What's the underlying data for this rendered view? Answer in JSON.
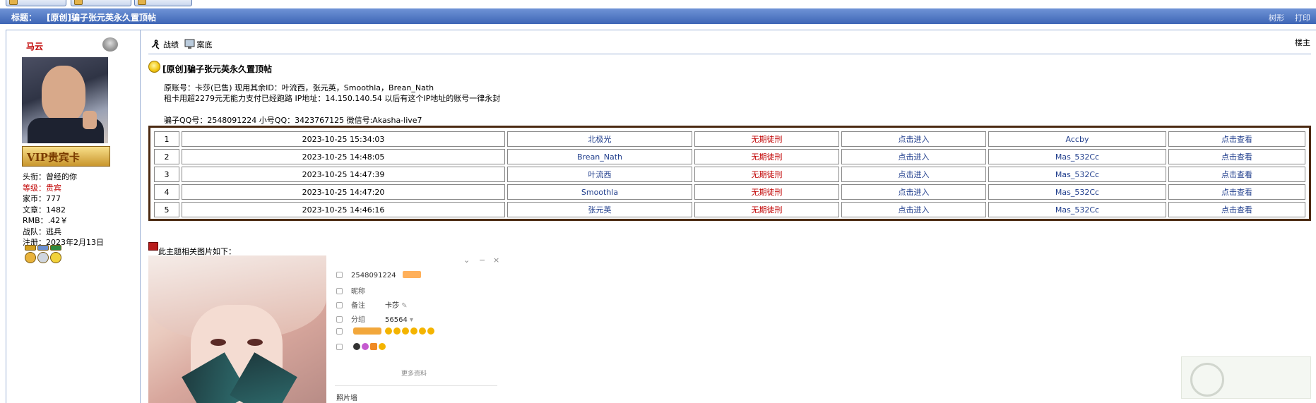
{
  "top_strip": {
    "buttons": [
      "",
      "",
      ""
    ],
    "right_text": [
      "",
      ""
    ]
  },
  "title_bar": {
    "label": "标题：",
    "title": "[原创]骗子张元英永久置顶帖",
    "tree_label": "树形",
    "print_label": "打印"
  },
  "user": {
    "name": "马云",
    "vip_card": "VIP贵宾卡",
    "info": [
      {
        "key": "头衔：",
        "value": "曾经的你",
        "highlight": false
      },
      {
        "key": "等级：",
        "value": "贵宾",
        "highlight": true
      },
      {
        "key": "家币：",
        "value": "777",
        "highlight": false
      },
      {
        "key": "文章：",
        "value": "1482",
        "highlight": false
      },
      {
        "key": "RMB：",
        "value": ".42￥",
        "highlight": false
      },
      {
        "key": "战队：",
        "value": "逃兵",
        "highlight": false
      },
      {
        "key": "注册：",
        "value": "2023年2月13日",
        "highlight": false
      }
    ]
  },
  "toolbar": {
    "record_label": "战绩",
    "case_label": "案底",
    "floor_label": "楼主"
  },
  "post": {
    "title": "[原创]骗子张元英永久置顶帖",
    "line1": "原账号：卡莎(已售)  现用其余ID：叶流西，张元英，Smoothla，Brean_Nath",
    "line2": "租卡用超2279元无能力支付已经跑路 IP地址：14.150.140.54 以后有这个IP地址的账号一律永封",
    "line3": "骗子QQ号：2548091224 小号QQ：3423767125  微信号:Akasha-live7"
  },
  "records": [
    {
      "no": "1",
      "time": "2023-10-25 15:34:03",
      "name": "北极光",
      "status": "无期徒刑",
      "enter": "点击进入",
      "by": "Accby",
      "view": "点击查看"
    },
    {
      "no": "2",
      "time": "2023-10-25 14:48:05",
      "name": "Brean_Nath",
      "status": "无期徒刑",
      "enter": "点击进入",
      "by": "Mas_532Cc",
      "view": "点击查看"
    },
    {
      "no": "3",
      "time": "2023-10-25 14:47:39",
      "name": "叶流西",
      "status": "无期徒刑",
      "enter": "点击进入",
      "by": "Mas_532Cc",
      "view": "点击查看"
    },
    {
      "no": "4",
      "time": "2023-10-25 14:47:20",
      "name": "Smoothla",
      "status": "无期徒刑",
      "enter": "点击进入",
      "by": "Mas_532Cc",
      "view": "点击查看"
    },
    {
      "no": "5",
      "time": "2023-10-25 14:46:16",
      "name": "张元英",
      "status": "无期徒刑",
      "enter": "点击进入",
      "by": "Mas_532Cc",
      "view": "点击查看"
    }
  ],
  "images": {
    "caption": "此主题相关图片如下：",
    "qq_card": {
      "qq_number": "2548091224",
      "nickname_key": "昵称",
      "remark_key": "备注",
      "remark_value": "卡莎",
      "group_key": "分组",
      "group_value": "56564",
      "more": "更多资料",
      "photos": "照片墙"
    }
  },
  "colors": {
    "title_bar": "#3e66b6",
    "link": "#1f3d8c",
    "status_red": "#c00000",
    "table_border": "#4b2a12"
  }
}
